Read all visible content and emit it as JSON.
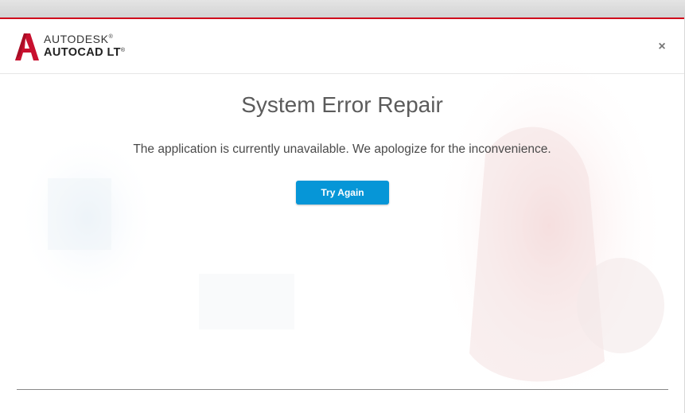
{
  "brand": {
    "line1": "AUTODESK",
    "line2": "AUTOCAD LT",
    "trademark": "®",
    "logo_icon": "autocad-a-logo-icon"
  },
  "dialog": {
    "title": "System Error Repair",
    "message": "The application is currently unavailable. We apologize for the inconvenience.",
    "try_again_label": "Try Again",
    "close_symbol": "×"
  },
  "colors": {
    "accent_red": "#d0021b",
    "button_blue": "#0696d7",
    "title_gray": "#5b5b5b"
  }
}
